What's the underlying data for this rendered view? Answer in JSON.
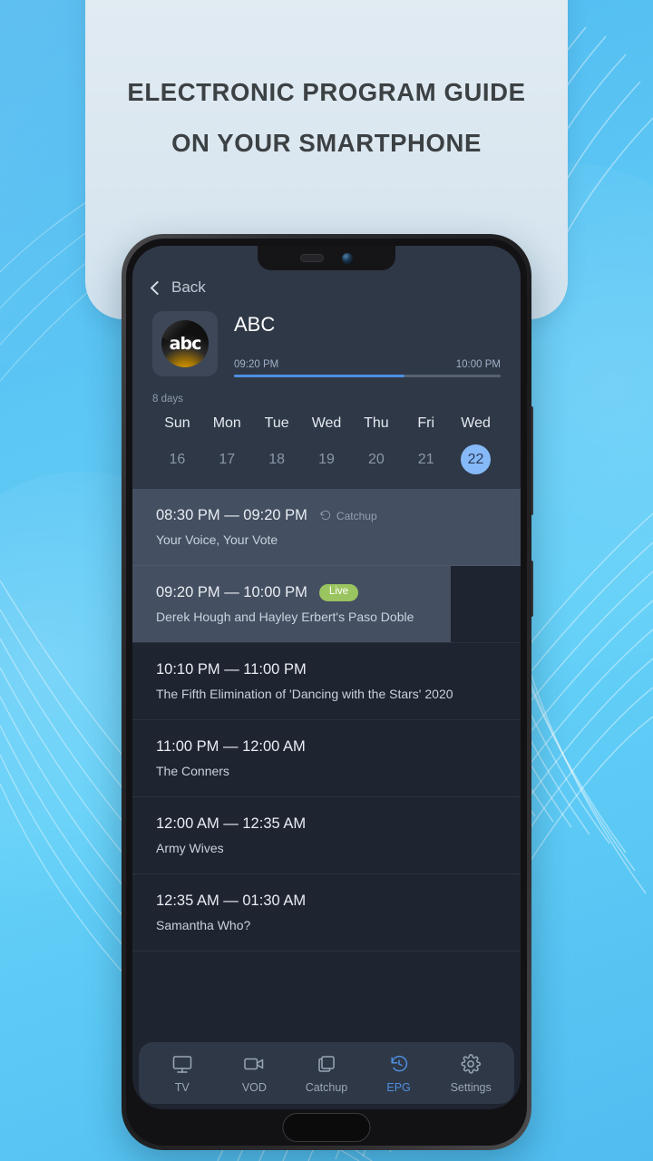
{
  "banner": {
    "headline_line1": "ELECTRONIC PROGRAM GUIDE",
    "headline_line2": "ON YOUR SMARTPHONE"
  },
  "colors": {
    "background_blue": "#4fc3f7",
    "banner_panel": "#e2ecf3",
    "header_slate": "#2f3847",
    "list_dark": "#1e2430",
    "row_highlight": "#444f61",
    "accent_blue": "#4d8fe0",
    "selected_day": "#86b9f7",
    "live_green": "#9ac45f"
  },
  "app": {
    "back": {
      "label": "Back",
      "icon": "chevron-left-icon"
    },
    "channel": {
      "name": "ABC",
      "logo_text": "abc",
      "start_time": "09:20 PM",
      "end_time": "10:00 PM",
      "progress_percent": 64
    },
    "days": {
      "count_label": "8 days",
      "items": [
        {
          "name": "Sun",
          "num": "16",
          "selected": false
        },
        {
          "name": "Mon",
          "num": "17",
          "selected": false
        },
        {
          "name": "Tue",
          "num": "18",
          "selected": false
        },
        {
          "name": "Wed",
          "num": "19",
          "selected": false
        },
        {
          "name": "Thu",
          "num": "20",
          "selected": false
        },
        {
          "name": "Fri",
          "num": "21",
          "selected": false
        },
        {
          "name": "Wed",
          "num": "22",
          "selected": true
        }
      ]
    },
    "programs": [
      {
        "time": "08:30 PM — 09:20 PM",
        "title": "Your Voice, Your Vote",
        "badge": "Catchup",
        "badge_type": "catchup",
        "state": "past"
      },
      {
        "time": "09:20 PM — 10:00 PM",
        "title": "Derek Hough and Hayley Erbert's Paso Doble",
        "badge": "Live",
        "badge_type": "live",
        "state": "live"
      },
      {
        "time": "10:10 PM — 11:00 PM",
        "title": "The Fifth Elimination of 'Dancing with the Stars' 2020",
        "badge": "",
        "badge_type": "none",
        "state": "upcoming"
      },
      {
        "time": "11:00 PM — 12:00 AM",
        "title": "The Conners",
        "badge": "",
        "badge_type": "none",
        "state": "upcoming"
      },
      {
        "time": "12:00 AM — 12:35 AM",
        "title": "Army Wives",
        "badge": "",
        "badge_type": "none",
        "state": "upcoming"
      },
      {
        "time": "12:35 AM — 01:30 AM",
        "title": "Samantha Who?",
        "badge": "",
        "badge_type": "none",
        "state": "upcoming"
      }
    ],
    "bottom_nav": [
      {
        "label": "TV",
        "icon": "monitor-icon",
        "active": false
      },
      {
        "label": "VOD",
        "icon": "video-camera-icon",
        "active": false
      },
      {
        "label": "Catchup",
        "icon": "layers-icon",
        "active": false
      },
      {
        "label": "EPG",
        "icon": "history-clock-icon",
        "active": true
      },
      {
        "label": "Settings",
        "icon": "gear-icon",
        "active": false
      }
    ]
  }
}
